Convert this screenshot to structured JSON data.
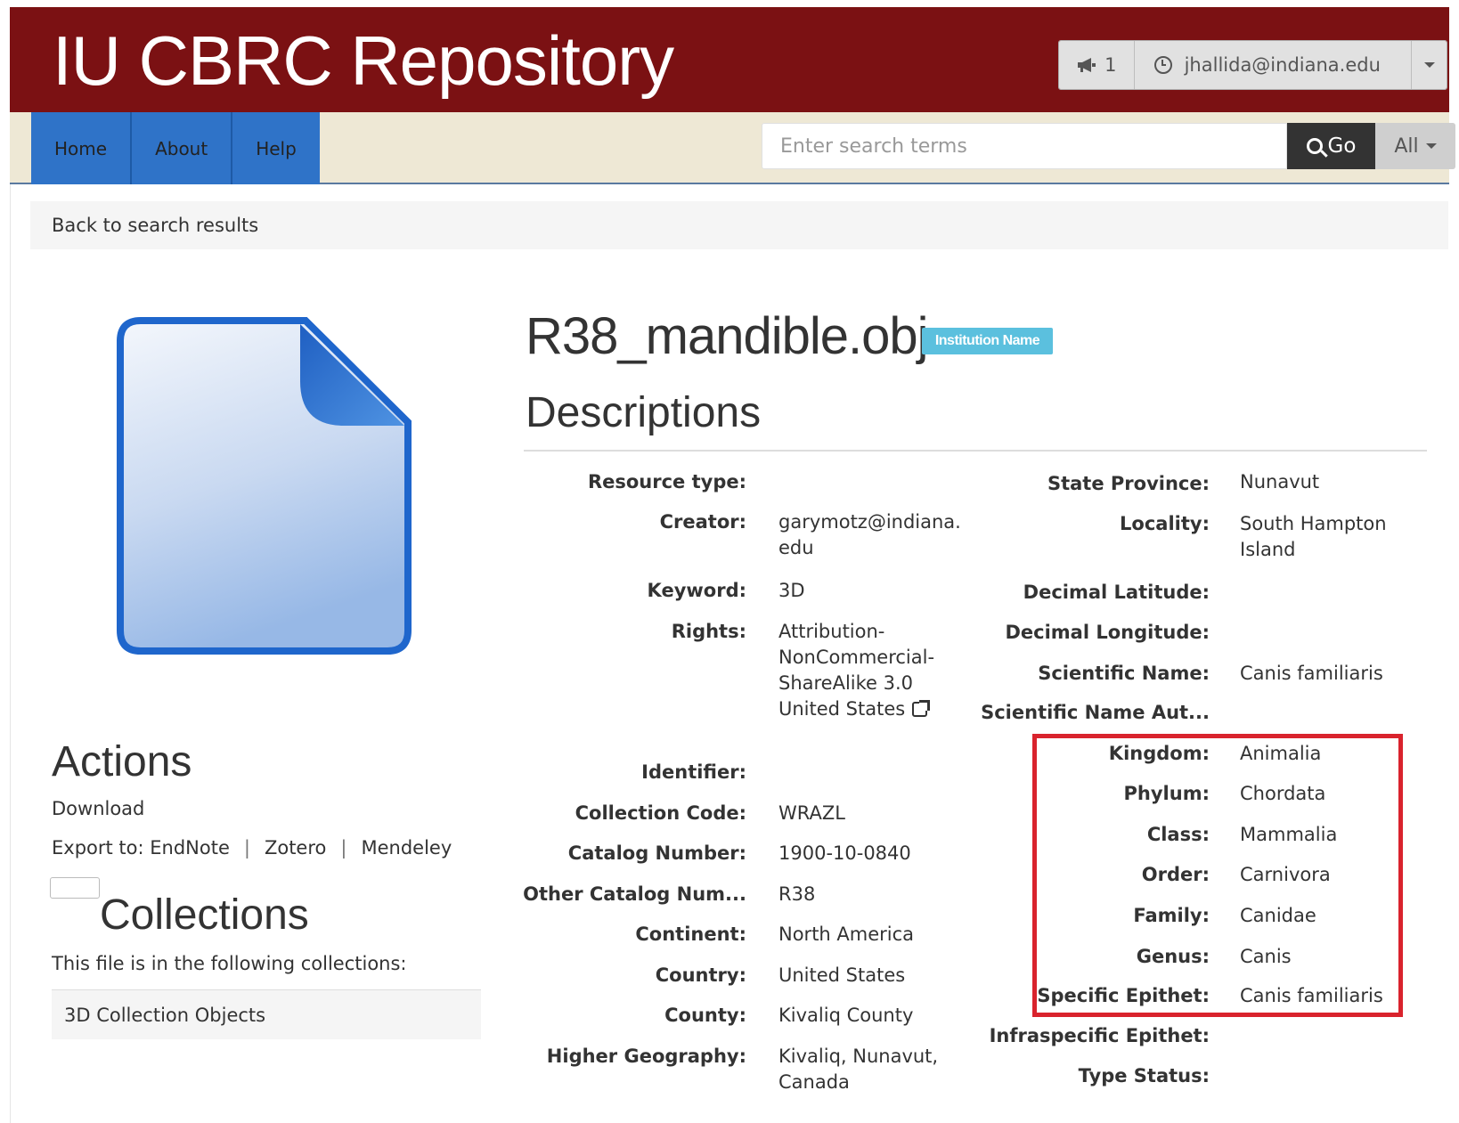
{
  "header": {
    "brand": "IU CBRC Repository",
    "notifications_count": "1",
    "user_email": "jhallida@indiana.edu"
  },
  "nav": {
    "items": [
      {
        "label": "Home"
      },
      {
        "label": "About"
      },
      {
        "label": "Help"
      }
    ]
  },
  "search": {
    "placeholder": "Enter search terms",
    "go_label": "Go",
    "scope_label": "All"
  },
  "breadcrumb": {
    "back_label": "Back to search results"
  },
  "actions": {
    "heading": "Actions",
    "download_label": "Download",
    "export_prefix": "Export to:",
    "export_options": [
      "EndNote",
      "Zotero",
      "Mendeley"
    ],
    "separator": "|"
  },
  "collections": {
    "heading": "Collections",
    "intro": "This file is in the following collections:",
    "items": [
      "3D Collection Objects"
    ]
  },
  "file": {
    "title": "R38_mandible.obj",
    "badge": "Institution Name",
    "descriptions_heading": "Descriptions"
  },
  "fields_left": [
    {
      "label": "Resource type:",
      "value": ""
    },
    {
      "label": "Creator:",
      "value": "garymotz@indiana.\nedu"
    },
    {
      "label": "Keyword:",
      "value": "3D"
    },
    {
      "label": "Rights:",
      "value": "Attribution-\nNonCommercial-\nShareAlike 3.0\nUnited States"
    },
    {
      "label": "Identifier:",
      "value": ""
    },
    {
      "label": "Collection Code:",
      "value": "WRAZL"
    },
    {
      "label": "Catalog Number:",
      "value": "1900-10-0840"
    },
    {
      "label": "Other Catalog Num...",
      "value": "R38"
    },
    {
      "label": "Continent:",
      "value": "North America"
    },
    {
      "label": "Country:",
      "value": "United States"
    },
    {
      "label": "County:",
      "value": "Kivaliq County"
    },
    {
      "label": "Higher Geography:",
      "value": "Kivaliq, Nunavut,\nCanada"
    }
  ],
  "fields_right": [
    {
      "label": "State Province:",
      "value": "Nunavut"
    },
    {
      "label": "Locality:",
      "value": "South Hampton\nIsland"
    },
    {
      "label": "Decimal Latitude:",
      "value": ""
    },
    {
      "label": "Decimal Longitude:",
      "value": ""
    },
    {
      "label": "Scientific Name:",
      "value": "Canis familiaris"
    },
    {
      "label": "Scientific Name Aut...",
      "value": ""
    },
    {
      "label": "Kingdom:",
      "value": "Animalia"
    },
    {
      "label": "Phylum:",
      "value": "Chordata"
    },
    {
      "label": "Class:",
      "value": "Mammalia"
    },
    {
      "label": "Order:",
      "value": "Carnivora"
    },
    {
      "label": "Family:",
      "value": "Canidae"
    },
    {
      "label": "Genus:",
      "value": "Canis"
    },
    {
      "label": "Specific Epithet:",
      "value": "Canis familiaris"
    },
    {
      "label": "Infraspecific Epithet:",
      "value": ""
    },
    {
      "label": "Type Status:",
      "value": ""
    }
  ],
  "colors": {
    "header_bg": "#7b1113",
    "nav_bg": "#eee8d5",
    "nav_tab_bg": "#2f73c8",
    "badge_bg": "#5bc0de",
    "highlight_border": "#d9232d"
  }
}
